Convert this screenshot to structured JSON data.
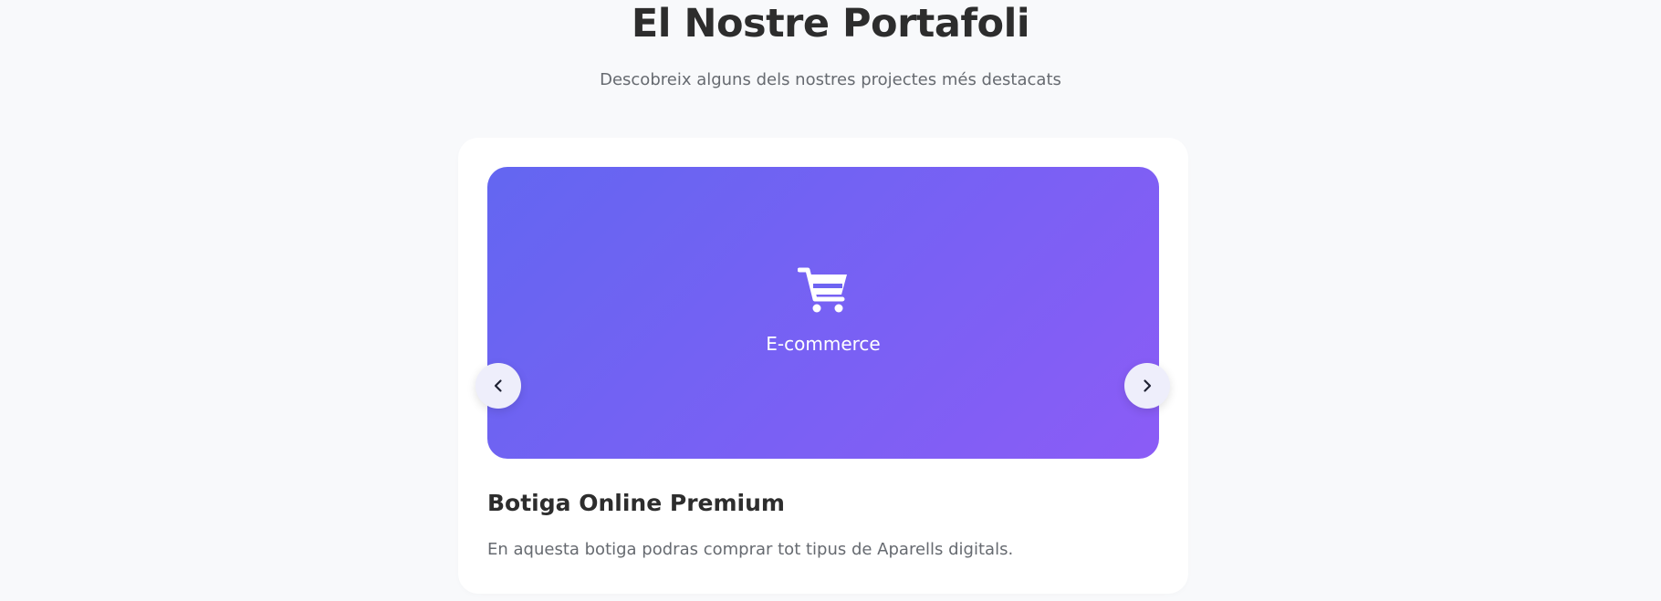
{
  "header": {
    "title": "El Nostre Portafoli",
    "subtitle": "Descobreix alguns dels nostres projectes més destacats"
  },
  "carousel": {
    "current_slide": {
      "category": "E-commerce",
      "category_icon": "shopping-cart-icon",
      "title": "Botiga Online Premium",
      "description": "En aquesta botiga podras comprar tot tipus de Aparells digitals."
    },
    "prev_icon": "chevron-left-icon",
    "next_icon": "chevron-right-icon"
  },
  "colors": {
    "gradient_start": "#6366f1",
    "gradient_end": "#8b5cf6",
    "page_background": "#f8f9fb",
    "card_background": "#ffffff",
    "title_text": "#2d2d2d",
    "muted_text": "#666a70"
  }
}
